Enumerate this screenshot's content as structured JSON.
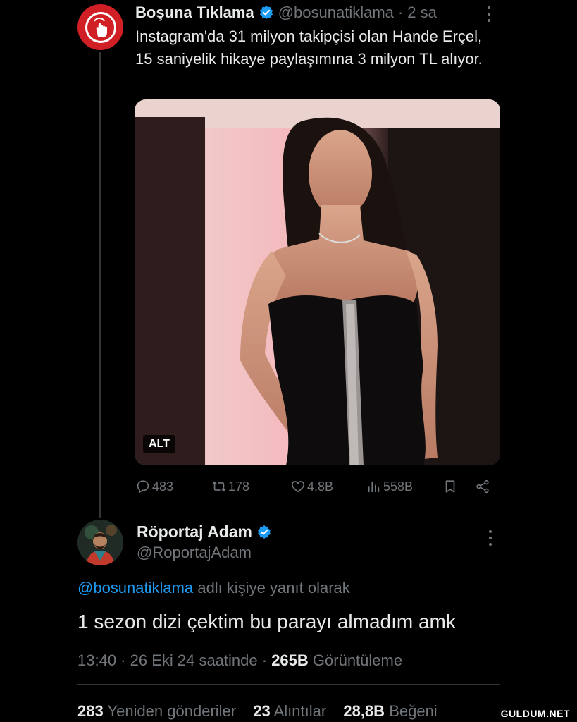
{
  "tweet": {
    "author_name": "Boşuna Tıklama",
    "handle": "@bosunatiklama",
    "separator": "·",
    "time": "2 sa",
    "text": "Instagram'da 31 milyon takipçisi olan Hande Erçel, 15 saniyelik hikaye paylaşımına 3 milyon TL alıyor.",
    "media_alt_badge": "ALT",
    "actions": {
      "replies": "483",
      "reposts": "178",
      "likes": "4,8B",
      "views": "558B"
    },
    "icons": [
      "reply-icon",
      "repost-icon",
      "like-icon",
      "views-icon",
      "bookmark-icon",
      "share-icon"
    ]
  },
  "reply": {
    "author_name": "Röportaj Adam",
    "handle": "@RoportajAdam",
    "reply_to_mention": "@bosunatiklama",
    "reply_to_suffix": "adlı kişiye yanıt olarak",
    "text": "1 sezon dizi çektim bu parayı almadım amk",
    "timestamp": "13:40 · 26 Eki 24 saatinde ·",
    "view_count": "265B",
    "view_label": "Görüntüleme",
    "stats": {
      "reposts_count": "283",
      "reposts_label": "Yeniden gönderiler",
      "quotes_count": "23",
      "quotes_label": "Alıntılar",
      "likes_count": "28,8B",
      "likes_label": "Beğeni"
    }
  },
  "watermark": "GULDUM.NET",
  "colors": {
    "background": "#000000",
    "text": "#e7e9ea",
    "secondary": "#71767b",
    "accent": "#1d9bf0",
    "brand_red": "#d11f26"
  }
}
